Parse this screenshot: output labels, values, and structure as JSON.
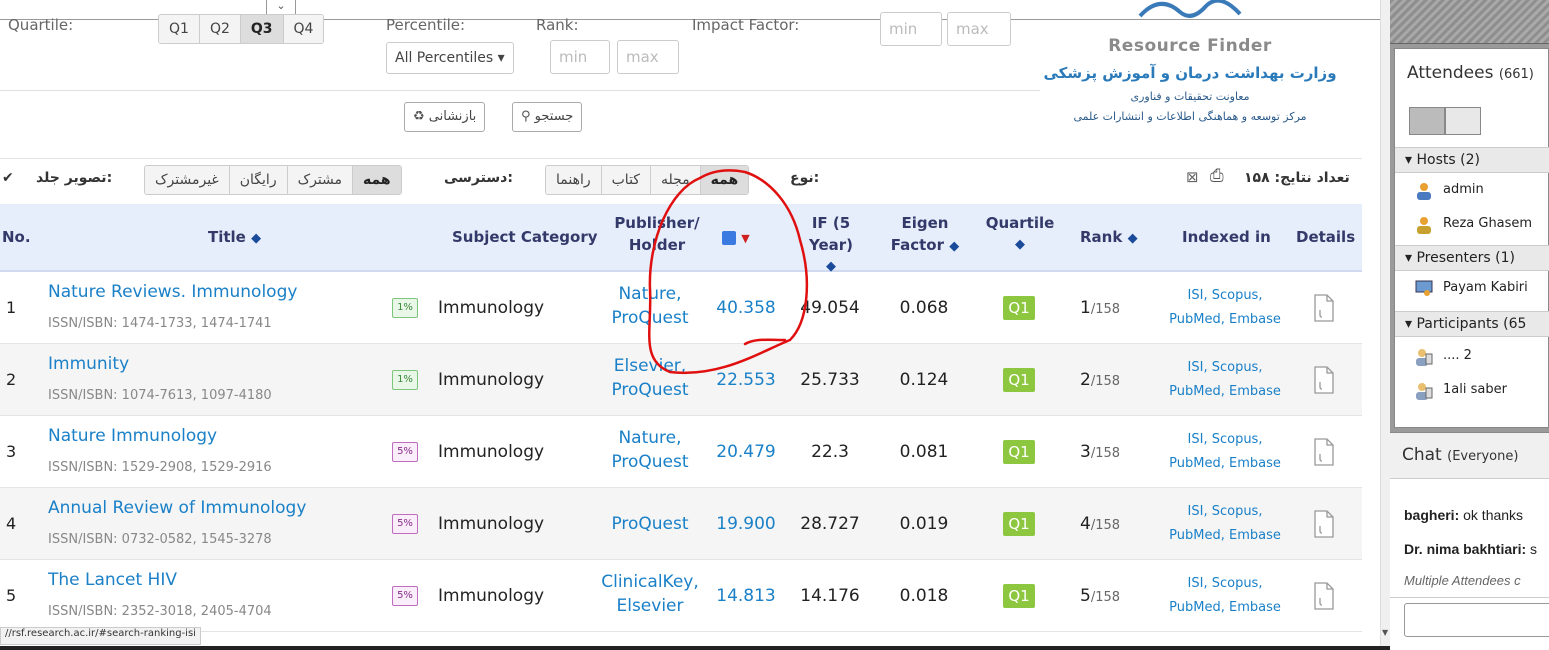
{
  "filters": {
    "quartile_label": "Quartile:",
    "quartiles": [
      "Q1",
      "Q2",
      "Q3",
      "Q4"
    ],
    "percentile_label": "Percentile:",
    "percentile_select": "All Percentiles ▾",
    "rank_label": "Rank:",
    "impact_label": "Impact Factor:",
    "min": "min",
    "max": "max",
    "search_btn": "جستجو",
    "reset_btn": "بازنشانی"
  },
  "logo": {
    "title": "Resource Finder",
    "line1": "وزارت بهداشت درمان و آموزش پزشکی",
    "line2": "معاونت تحقیقات و فناوری",
    "line3": "مرکز توسعه و هماهنگی اطلاعات و انتشارات علمی"
  },
  "toolbar": {
    "cover_label": "تصویر جلد:",
    "access_label": "دسترسی:",
    "access_opts": [
      "غیرمشترک",
      "رایگان",
      "مشترک",
      "همه"
    ],
    "type_label": "نوع:",
    "type_opts": [
      "راهنما",
      "کتاب",
      "مجله",
      "همه"
    ],
    "results_label": "تعداد نتایج: ۱۵۸"
  },
  "columns": {
    "no": "No.",
    "title": "Title",
    "subject": "Subject Category",
    "publisher_1": "Publisher/",
    "publisher_2": "Holder",
    "if5_1": "IF (5 Year)",
    "eigen_1": "Eigen",
    "eigen_2": "Factor",
    "quartile": "Quartile",
    "rank": "Rank",
    "indexed": "Indexed in",
    "details": "Details"
  },
  "rows": [
    {
      "no": "1",
      "title": "Nature Reviews. Immunology",
      "issn": "ISSN/ISBN: 1474-1733, 1474-1741",
      "pct": "1%",
      "cat": "Immunology",
      "pub1": "Nature,",
      "pub2": "ProQuest",
      "if": "40.358",
      "if5": "49.054",
      "eig": "0.068",
      "q": "Q1",
      "rank": "1",
      "of": "/158",
      "idx1": "ISI, Scopus,",
      "idx2": "PubMed, Embase"
    },
    {
      "no": "2",
      "title": "Immunity",
      "issn": "ISSN/ISBN: 1074-7613, 1097-4180",
      "pct": "1%",
      "cat": "Immunology",
      "pub1": "Elsevier,",
      "pub2": "ProQuest",
      "if": "22.553",
      "if5": "25.733",
      "eig": "0.124",
      "q": "Q1",
      "rank": "2",
      "of": "/158",
      "idx1": "ISI, Scopus,",
      "idx2": "PubMed, Embase"
    },
    {
      "no": "3",
      "title": "Nature Immunology",
      "issn": "ISSN/ISBN: 1529-2908, 1529-2916",
      "pct": "5%",
      "cat": "Immunology",
      "pub1": "Nature,",
      "pub2": "ProQuest",
      "if": "20.479",
      "if5": "22.3",
      "eig": "0.081",
      "q": "Q1",
      "rank": "3",
      "of": "/158",
      "idx1": "ISI, Scopus,",
      "idx2": "PubMed, Embase"
    },
    {
      "no": "4",
      "title": "Annual Review of Immunology",
      "issn": "ISSN/ISBN: 0732-0582, 1545-3278",
      "pct": "5%",
      "cat": "Immunology",
      "pub1": "ProQuest",
      "pub2": "",
      "if": "19.900",
      "if5": "28.727",
      "eig": "0.019",
      "q": "Q1",
      "rank": "4",
      "of": "/158",
      "idx1": "ISI, Scopus,",
      "idx2": "PubMed, Embase"
    },
    {
      "no": "5",
      "title": "The Lancet HIV",
      "issn": "ISSN/ISBN: 2352-3018, 2405-4704",
      "pct": "5%",
      "cat": "Immunology",
      "pub1": "ClinicalKey,",
      "pub2": "Elsevier",
      "if": "14.813",
      "if5": "14.176",
      "eig": "0.018",
      "q": "Q1",
      "rank": "5",
      "of": "/158",
      "idx1": "ISI, Scopus,",
      "idx2": "PubMed, Embase"
    }
  ],
  "status_url": "//rsf.research.ac.ir/#search-ranking-isi",
  "attendees": {
    "title": "Attendees",
    "count": "(661)",
    "hosts": "Hosts (2)",
    "host_users": [
      "admin",
      "Reza Ghasem"
    ],
    "presenters": "Presenters (1)",
    "presenter_users": [
      "Payam Kabiri"
    ],
    "participants": "Participants (65",
    "participant_users": [
      ".... 2",
      "1ali saber"
    ]
  },
  "chat": {
    "title": "Chat",
    "scope": "(Everyone)",
    "msg1_user": "bagheri:",
    "msg1_text": " ok thanks",
    "msg2_user": "Dr. nima bakhtiari:",
    "msg2_text": " s",
    "note": "Multiple Attendees c"
  },
  "colors": {
    "link": "#1a80c8",
    "header_bg": "#e6eefb",
    "quartile_badge": "#8dc63f",
    "annotation": "#e01010"
  }
}
